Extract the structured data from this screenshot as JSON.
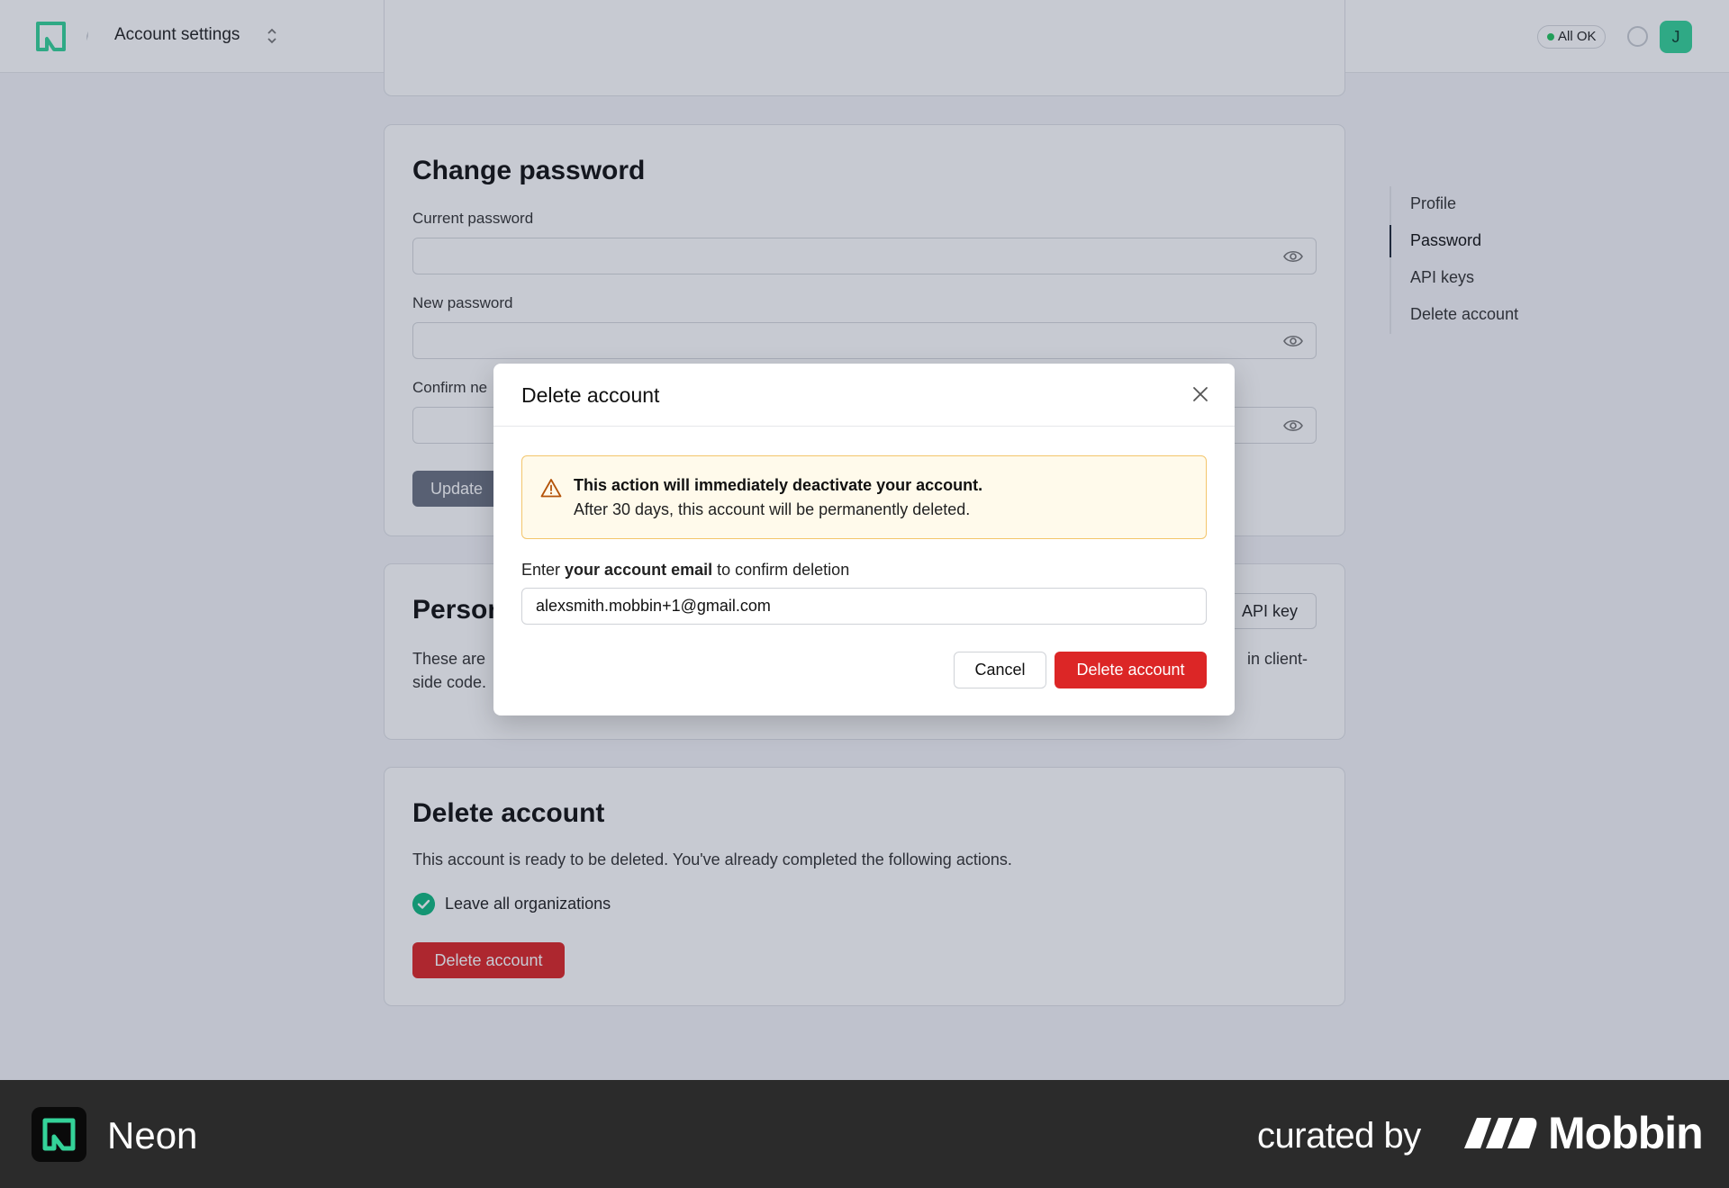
{
  "header": {
    "breadcrumb": "Account settings",
    "status_label": "All OK",
    "avatar_initial": "J"
  },
  "right_nav": {
    "items": [
      "Profile",
      "Password",
      "API keys",
      "Delete account"
    ],
    "active": "Password"
  },
  "change_password": {
    "title": "Change password",
    "current_label": "Current password",
    "new_label": "New password",
    "confirm_label": "Confirm ne",
    "update_label": "Update"
  },
  "api_keys": {
    "title_fragment": "Persor",
    "button_fragment": "API key",
    "description_left": "These are",
    "description_left_2": "side code.",
    "description_right": "in client-"
  },
  "delete_card": {
    "title": "Delete account",
    "description": "This account is ready to be deleted. You've already completed the following actions.",
    "checklist_item": "Leave all organizations",
    "button_label": "Delete account"
  },
  "modal": {
    "title": "Delete account",
    "warning_title": "This action will immediately deactivate your account.",
    "warning_body": "After 30 days, this account will be permanently deleted.",
    "confirm_prefix": "Enter",
    "confirm_bold": "your account email",
    "confirm_suffix": "to confirm deletion",
    "email_value": "alexsmith.mobbin+1@gmail.com",
    "cancel_label": "Cancel",
    "delete_label": "Delete account"
  },
  "footer": {
    "app_name": "Neon",
    "curated_by": "curated by",
    "brand": "Mobbin"
  },
  "colors": {
    "danger": "#dc2626",
    "neon_green": "#34d399",
    "warning_bg": "#fffaeb",
    "warning_border": "#f3c56b"
  },
  "icons": [
    "neon-logo-icon",
    "chevron-updown-icon",
    "eye-icon",
    "close-icon",
    "warning-triangle-icon",
    "check-icon",
    "mobbin-logo-icon"
  ]
}
